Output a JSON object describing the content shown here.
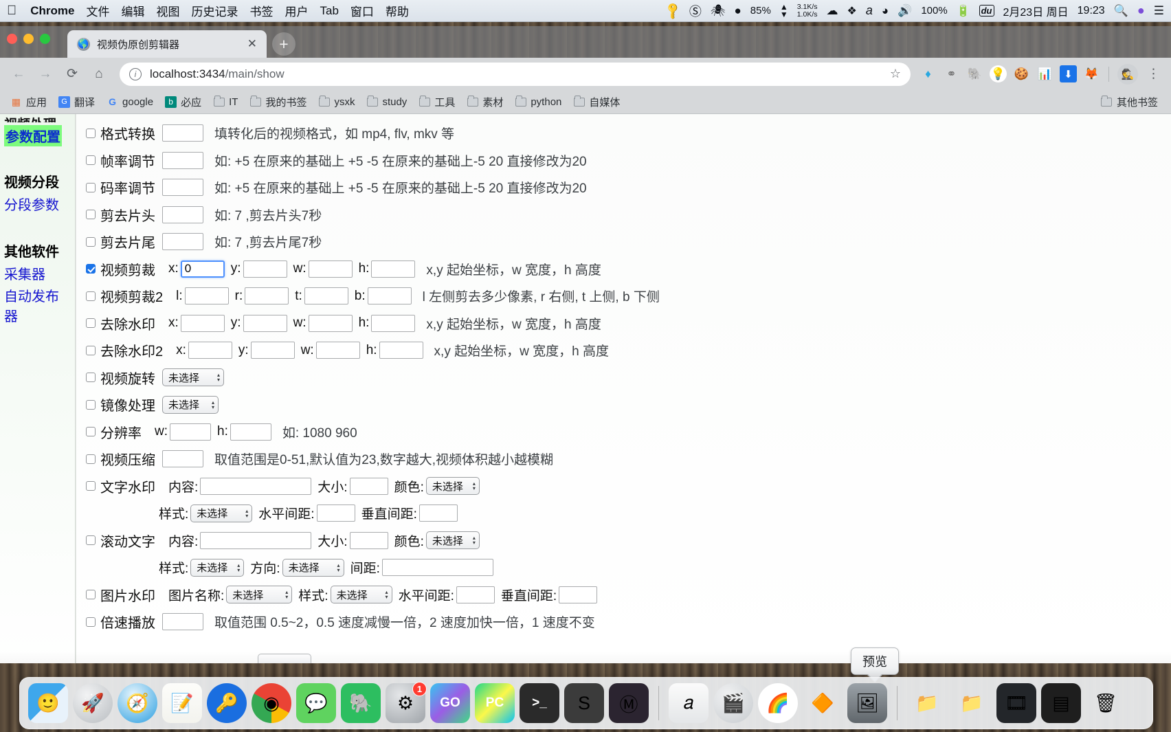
{
  "menubar": {
    "apple": "",
    "app": "Chrome",
    "items": [
      "文件",
      "编辑",
      "视图",
      "历史记录",
      "书签",
      "用户",
      "Tab",
      "窗口",
      "帮助"
    ],
    "status": {
      "key_icon": "key-icon",
      "adobe_icon": "adobe-cc-icon",
      "docker_icon": "docker-icon",
      "battery_drop_icon": "battery-droplet-icon",
      "battery_pct": "85%",
      "net_up": "3.1K/s",
      "net_down": "1.0K/s",
      "cloud_icon": "cloud-icon",
      "dropbox_icon": "dropbox-icon",
      "alfred_icon": "alfred-icon",
      "wifi_icon": "wifi-icon",
      "volume_icon": "volume-icon",
      "power_pct": "100%",
      "charging_icon": "battery-charging-icon",
      "du_icon": "du-icon",
      "date": "2月23日 周日",
      "time": "19:23",
      "spotlight_icon": "search-icon",
      "siri_icon": "siri-icon",
      "control_center_icon": "menu-list-icon"
    }
  },
  "browser": {
    "tab": {
      "title": "视频伪原创剪辑器",
      "close_label": "✕",
      "favicon": "globe-icon"
    },
    "new_tab_label": "+",
    "nav": {
      "back": "←",
      "forward": "→",
      "reload": "⟳",
      "home": "⌂"
    },
    "omnibox": {
      "info_icon": "info-icon",
      "url_host": "localhost:3434",
      "url_path": "/main/show",
      "star_icon": "star-icon"
    },
    "extensions": [
      {
        "name": "diamond-extension-icon",
        "glyph": "◆",
        "color": "#2196f3"
      },
      {
        "name": "molecule-extension-icon",
        "glyph": "⚭",
        "color": "#6b6b6b"
      },
      {
        "name": "evernote-extension-icon",
        "glyph": "🐘",
        "color": "#2dbe60"
      },
      {
        "name": "lightbulb-extension-icon",
        "glyph": "💡",
        "color": "#00a8e8"
      },
      {
        "name": "cookie-extension-icon",
        "glyph": "🍪",
        "color": "#d39b4b"
      },
      {
        "name": "sitemap-extension-icon",
        "glyph": "🗂",
        "color": "#e05c5c"
      },
      {
        "name": "download-extension-icon",
        "glyph": "⬇",
        "color": "#1a73e8"
      },
      {
        "name": "fox-extension-icon",
        "glyph": "🦊",
        "color": "#e8732b"
      }
    ],
    "profile_avatar": "ninja-avatar",
    "menu_icon": "kebab-menu-icon",
    "bookmarks": [
      {
        "label": "应用",
        "icon": "apps-grid-icon"
      },
      {
        "label": "翻译",
        "icon": "translate-icon"
      },
      {
        "label": "google",
        "icon": "google-icon"
      },
      {
        "label": "必应",
        "icon": "bing-icon"
      },
      {
        "label": "IT",
        "icon": "folder-icon"
      },
      {
        "label": "我的书签",
        "icon": "folder-icon"
      },
      {
        "label": "ysxk",
        "icon": "folder-icon"
      },
      {
        "label": "study",
        "icon": "folder-icon"
      },
      {
        "label": "工具",
        "icon": "folder-icon"
      },
      {
        "label": "素材",
        "icon": "folder-icon"
      },
      {
        "label": "python",
        "icon": "folder-icon"
      },
      {
        "label": "自媒体",
        "icon": "folder-icon"
      }
    ],
    "other_bookmarks": {
      "label": "其他书签",
      "icon": "folder-icon"
    }
  },
  "sidebar": {
    "clipped_heading": "视频处理",
    "active_item": "参数配置",
    "groups": [
      {
        "heading": "视频分段",
        "links": [
          "分段参数"
        ]
      },
      {
        "heading": "其他软件",
        "links": [
          "采集器",
          "自动发布器"
        ]
      }
    ]
  },
  "form": {
    "rows": [
      {
        "label": "格式转换",
        "checked": false,
        "fields": [
          {
            "type": "text",
            "w": "w60",
            "value": ""
          }
        ],
        "hint": "填转化后的视频格式，如 mp4, flv, mkv 等"
      },
      {
        "label": "帧率调节",
        "checked": false,
        "fields": [
          {
            "type": "text",
            "w": "w60",
            "value": ""
          }
        ],
        "hint": "如: +5 在原来的基础上 +5 -5 在原来的基础上-5 20 直接修改为20"
      },
      {
        "label": "码率调节",
        "checked": false,
        "fields": [
          {
            "type": "text",
            "w": "w60",
            "value": ""
          }
        ],
        "hint": "如: +5 在原来的基础上 +5 -5 在原来的基础上-5 20 直接修改为20"
      },
      {
        "label": "剪去片头",
        "checked": false,
        "fields": [
          {
            "type": "text",
            "w": "w60",
            "value": ""
          }
        ],
        "hint": "如: 7 ,剪去片头7秒"
      },
      {
        "label": "剪去片尾",
        "checked": false,
        "fields": [
          {
            "type": "text",
            "w": "w60",
            "value": ""
          }
        ],
        "hint": "如: 7 ,剪去片尾7秒"
      },
      {
        "label": "视频剪裁",
        "checked": true,
        "fields": [
          {
            "type": "text",
            "prefix": "x:",
            "w": "w64",
            "value": "0",
            "focused": true
          },
          {
            "type": "text",
            "prefix": "y:",
            "w": "w64",
            "value": ""
          },
          {
            "type": "text",
            "prefix": "w:",
            "w": "w64",
            "value": ""
          },
          {
            "type": "text",
            "prefix": "h:",
            "w": "w64",
            "value": ""
          }
        ],
        "hint": "x,y 起始坐标，w 宽度，h 高度"
      },
      {
        "label": "视频剪裁2",
        "checked": false,
        "fields": [
          {
            "type": "text",
            "prefix": "l:",
            "w": "w64",
            "value": ""
          },
          {
            "type": "text",
            "prefix": "r:",
            "w": "w64",
            "value": ""
          },
          {
            "type": "text",
            "prefix": "t:",
            "w": "w64",
            "value": ""
          },
          {
            "type": "text",
            "prefix": "b:",
            "w": "w64",
            "value": ""
          }
        ],
        "hint": "l 左侧剪去多少像素, r 右侧, t 上侧, b 下侧"
      },
      {
        "label": "去除水印",
        "checked": false,
        "fields": [
          {
            "type": "text",
            "prefix": "x:",
            "w": "w64",
            "value": ""
          },
          {
            "type": "text",
            "prefix": "y:",
            "w": "w64",
            "value": ""
          },
          {
            "type": "text",
            "prefix": "w:",
            "w": "w64",
            "value": ""
          },
          {
            "type": "text",
            "prefix": "h:",
            "w": "w64",
            "value": ""
          }
        ],
        "hint": "x,y 起始坐标，w 宽度，h 高度"
      },
      {
        "label": "去除水印2",
        "checked": false,
        "fields": [
          {
            "type": "text",
            "prefix": "x:",
            "w": "w64",
            "value": ""
          },
          {
            "type": "text",
            "prefix": "y:",
            "w": "w64",
            "value": ""
          },
          {
            "type": "text",
            "prefix": "w:",
            "w": "w64",
            "value": ""
          },
          {
            "type": "text",
            "prefix": "h:",
            "w": "w64",
            "value": ""
          }
        ],
        "hint": "x,y 起始坐标，w 宽度，h 高度"
      },
      {
        "label": "视频旋转",
        "checked": false,
        "fields": [
          {
            "type": "select",
            "w": "w86",
            "value": "未选择"
          }
        ],
        "hint": ""
      },
      {
        "label": "镜像处理",
        "checked": false,
        "fields": [
          {
            "type": "select",
            "w": "w78",
            "value": "未选择"
          }
        ],
        "hint": ""
      },
      {
        "label": "分辨率",
        "checked": false,
        "fields": [
          {
            "type": "text",
            "prefix": "w:",
            "w": "w60",
            "value": ""
          },
          {
            "type": "text",
            "prefix": "h:",
            "w": "w60",
            "value": ""
          }
        ],
        "hint": "如: 1080 960"
      },
      {
        "label": "视频压缩",
        "checked": false,
        "fields": [
          {
            "type": "text",
            "w": "w60",
            "value": ""
          }
        ],
        "hint": "取值范围是0-51,默认值为23,数字越大,视频体积越小越模糊"
      },
      {
        "label": "文字水印",
        "checked": false,
        "fields": [
          {
            "type": "text",
            "prefix": "内容:",
            "w": "w160",
            "value": ""
          },
          {
            "type": "text",
            "prefix": "大小:",
            "w": "w56",
            "value": ""
          },
          {
            "type": "select",
            "prefix": "颜色:",
            "w": "w74",
            "value": "未选择"
          }
        ],
        "hint": ""
      },
      {
        "label": "",
        "sub": true,
        "fields": [
          {
            "type": "select",
            "prefix": "样式:",
            "w": "w86",
            "value": "未选择"
          },
          {
            "type": "text",
            "prefix": "水平间距:",
            "w": "w56",
            "value": ""
          },
          {
            "type": "text",
            "prefix": "垂直间距:",
            "w": "w56",
            "value": ""
          }
        ],
        "hint": ""
      },
      {
        "label": "滚动文字",
        "checked": false,
        "fields": [
          {
            "type": "text",
            "prefix": "内容:",
            "w": "w160",
            "value": ""
          },
          {
            "type": "text",
            "prefix": "大小:",
            "w": "w56",
            "value": ""
          },
          {
            "type": "select",
            "prefix": "颜色:",
            "w": "w74",
            "value": "未选择"
          }
        ],
        "hint": ""
      },
      {
        "label": "",
        "sub": true,
        "fields": [
          {
            "type": "select",
            "prefix": "样式:",
            "w": "w74",
            "value": "未选择"
          },
          {
            "type": "select",
            "prefix": "方向:",
            "w": "w86",
            "value": "未选择"
          },
          {
            "type": "text",
            "prefix": "间距:",
            "w": "w160",
            "value": ""
          }
        ],
        "hint": ""
      },
      {
        "label": "图片水印",
        "checked": false,
        "fields": [
          {
            "type": "select",
            "prefix": "图片名称:",
            "w": "w94",
            "value": "未选择"
          },
          {
            "type": "select",
            "prefix": "样式:",
            "w": "w86",
            "value": "未选择"
          },
          {
            "type": "text",
            "prefix": "水平间距:",
            "w": "w56",
            "value": ""
          },
          {
            "type": "text",
            "prefix": "垂直间距:",
            "w": "w56",
            "value": ""
          }
        ],
        "hint": ""
      },
      {
        "label": "倍速播放",
        "checked": false,
        "fields": [
          {
            "type": "text",
            "w": "w60",
            "value": ""
          }
        ],
        "hint": "取值范围 0.5~2，0.5 速度减慢一倍，2 速度加快一倍，1 速度不变"
      }
    ]
  },
  "tooltip": {
    "text": "预览"
  },
  "dock": {
    "items": [
      {
        "name": "finder",
        "glyph": "🙂",
        "bg": "linear-gradient(135deg,#3ea7ec 50%, #e8f2fb 50%)",
        "shape": "rounded"
      },
      {
        "name": "launchpad",
        "glyph": "🚀",
        "bg": "radial-gradient(circle at 35% 30%, #f2f3f4, #b9bdc1)",
        "shape": "circle"
      },
      {
        "name": "safari",
        "glyph": "🧭",
        "bg": "radial-gradient(circle at 40% 30%, #e9f6fd, #2a9ee0)",
        "shape": "circle"
      },
      {
        "name": "notes",
        "glyph": "📝",
        "bg": "linear-gradient(#fdfdfa,#f3f3ee)",
        "shape": "rounded"
      },
      {
        "name": "1password",
        "glyph": "🔑",
        "bg": "#1a6ee0",
        "shape": "circle"
      },
      {
        "name": "chrome",
        "glyph": "◉",
        "bg": "conic-gradient(#ea4335 0 33%, #fbbc05 33% 50%, #34a853 50% 83%, #ea4335 83%)",
        "shape": "circle"
      },
      {
        "name": "wechat",
        "glyph": "💬",
        "bg": "#5fd35f",
        "shape": "rounded"
      },
      {
        "name": "evernote",
        "glyph": "🐘",
        "bg": "#2dbe60",
        "shape": "rounded"
      },
      {
        "name": "system-preferences",
        "glyph": "⚙",
        "bg": "radial-gradient(circle at 35% 30%,#e4e6e8,#9ea3a8)",
        "shape": "rounded",
        "badge": "1"
      },
      {
        "name": "goland",
        "glyph": "GO",
        "bg": "linear-gradient(135deg,#37c5f0,#9b5de5,#3ddc84)",
        "shape": "rounded",
        "label": true
      },
      {
        "name": "pycharm",
        "glyph": "PC",
        "bg": "linear-gradient(135deg,#21d789,#fcf84a,#07c3f2)",
        "shape": "rounded",
        "label": true
      },
      {
        "name": "terminal",
        "glyph": ">_",
        "bg": "#2a2a2a",
        "shape": "rounded",
        "label": true
      },
      {
        "name": "sublime-text",
        "glyph": "S",
        "bg": "#3b3b3b",
        "shape": "rounded"
      },
      {
        "name": "macvim",
        "glyph": "Ⓜ",
        "bg": "#2b2430",
        "shape": "rounded"
      },
      {
        "name": "divider-1",
        "glyph": "",
        "divider": true
      },
      {
        "name": "typora",
        "glyph": "𝑎",
        "bg": "linear-gradient(#fbfbfb,#e4e6e8)",
        "shape": "rounded"
      },
      {
        "name": "imovie",
        "glyph": "🎬",
        "bg": "radial-gradient(circle at 35% 30%,#f0f1f2,#c8ccd0)",
        "shape": "circle"
      },
      {
        "name": "photos",
        "glyph": "🌈",
        "bg": "#ffffff",
        "shape": "circle"
      },
      {
        "name": "vlc",
        "glyph": "🔶",
        "bg": "transparent",
        "shape": "rounded"
      },
      {
        "name": "preview",
        "glyph": "🖼",
        "bg": "linear-gradient(#9ba2a8,#60666b)",
        "shape": "rounded"
      },
      {
        "name": "divider-2",
        "glyph": "",
        "divider": true
      },
      {
        "name": "folder-1",
        "glyph": "📁",
        "bg": "transparent",
        "shape": "rounded"
      },
      {
        "name": "folder-2",
        "glyph": "📁",
        "bg": "transparent",
        "shape": "rounded"
      },
      {
        "name": "video-editor-window",
        "glyph": "🎞",
        "bg": "#23262a",
        "shape": "rounded"
      },
      {
        "name": "sublime-window",
        "glyph": "▤",
        "bg": "#1e1e1e",
        "shape": "rounded"
      },
      {
        "name": "trash",
        "glyph": "🗑",
        "bg": "transparent",
        "shape": "rounded"
      }
    ]
  }
}
